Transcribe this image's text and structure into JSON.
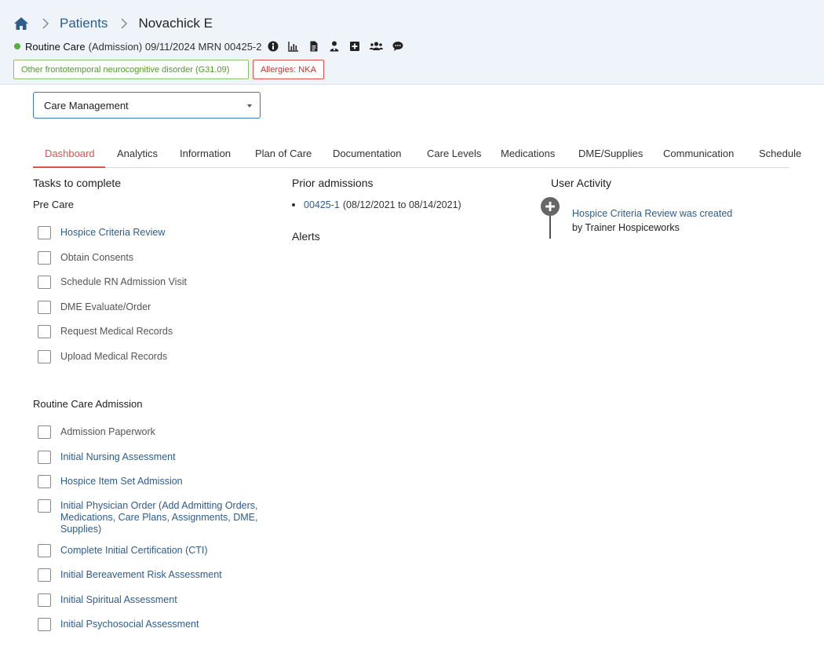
{
  "breadcrumb": {
    "home_icon": "home-icon",
    "patients": "Patients",
    "current": "Novachick E"
  },
  "status": {
    "dot_color": "#5aac44",
    "care_type": "Routine Care",
    "admission_info": "(Admission) 09/11/2024 MRN 00425-2",
    "icons": [
      "info-icon",
      "chart-icon",
      "document-icon",
      "physician-icon",
      "plus-square-icon",
      "users-icon",
      "comment-icon"
    ]
  },
  "badges": {
    "diagnosis": "Other frontotemporal neurocognitive disorder (G31.09)",
    "allergies": "Allergies: NKA"
  },
  "care_select": {
    "value": "Care Management"
  },
  "tabs": [
    {
      "label": "Dashboard",
      "active": true
    },
    {
      "label": "Analytics"
    },
    {
      "label": "Information"
    },
    {
      "label": "Plan of Care"
    },
    {
      "label": "Documentation"
    },
    {
      "label": "Care Levels"
    },
    {
      "label": "Medications"
    },
    {
      "label": "DME/Supplies"
    },
    {
      "label": "Communication"
    },
    {
      "label": "Schedule"
    }
  ],
  "tasks": {
    "title": "Tasks to complete",
    "pre_care": {
      "title": "Pre Care",
      "items": [
        {
          "label": "Hospice Criteria Review",
          "link": true
        },
        {
          "label": "Obtain Consents"
        },
        {
          "label": "Schedule RN Admission Visit"
        },
        {
          "label": "DME Evaluate/Order"
        },
        {
          "label": "Request Medical Records"
        },
        {
          "label": "Upload Medical Records"
        }
      ]
    },
    "routine_care": {
      "title": "Routine Care Admission",
      "items": [
        {
          "label": "Admission Paperwork"
        },
        {
          "label": "Initial Nursing Assessment",
          "link": true
        },
        {
          "label": "Hospice Item Set Admission",
          "link": true
        },
        {
          "label": "Initial Physician Order (Add Admitting Orders, Medications, Care Plans, Assignments, DME, Supplies)",
          "link": true
        },
        {
          "label": "Complete Initial Certification (CTI)",
          "link": true
        },
        {
          "label": "Initial Bereavement Risk Assessment",
          "link": true
        },
        {
          "label": "Initial Spiritual Assessment",
          "link": true
        },
        {
          "label": "Initial Psychosocial Assessment",
          "link": true
        }
      ]
    }
  },
  "prior_admissions": {
    "title": "Prior admissions",
    "items": [
      {
        "id": "00425-1",
        "range": "(08/12/2021 to 08/14/2021)"
      }
    ]
  },
  "alerts": {
    "title": "Alerts"
  },
  "user_activity": {
    "title": "User Activity",
    "items": [
      {
        "icon": "plus-circle-icon",
        "text": "Hospice Criteria Review was created",
        "by": "by Trainer Hospiceworks"
      }
    ]
  }
}
